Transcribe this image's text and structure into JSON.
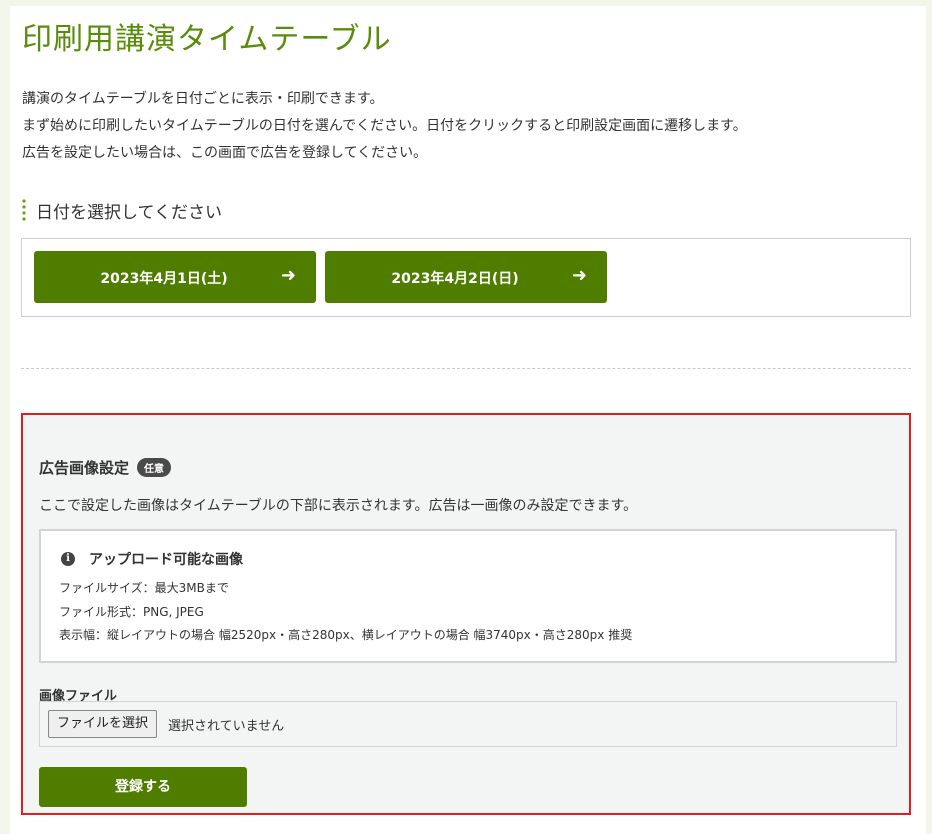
{
  "page": {
    "title": "印刷用講演タイムテーブル",
    "intro": [
      "講演のタイムテーブルを日付ごとに表示・印刷できます。",
      "まず始めに印刷したいタイムテーブルの日付を選んでください。日付をクリックすると印刷設定画面に遷移します。",
      "広告を設定したい場合は、この画面で広告を登録してください。"
    ]
  },
  "date_section": {
    "heading": "日付を選択してください",
    "dates": [
      {
        "label": "2023年4月1日(土)",
        "arrow": "➜"
      },
      {
        "label": "2023年4月2日(日)",
        "arrow": "➜"
      }
    ]
  },
  "ad_section": {
    "title": "広告画像設定",
    "badge": "任意",
    "description": "ここで設定した画像はタイムテーブルの下部に表示されます。広告は一画像のみ設定できます。",
    "info": {
      "icon": "i",
      "heading": "アップロード可能な画像",
      "lines": [
        "ファイルサイズ：最大3MBまで",
        "ファイル形式：PNG, JPEG",
        "表示幅：縦レイアウトの場合 幅2520px・高さ280px、横レイアウトの場合 幅3740px・高さ280px 推奨"
      ]
    },
    "file_label": "画像ファイル",
    "file_button": "ファイルを選択",
    "file_status": "選択されていません",
    "submit_label": "登録する"
  },
  "colors": {
    "accent_green": "#4f7d00",
    "title_green": "#5a8c0c",
    "highlight_border": "#dd1f1f"
  }
}
